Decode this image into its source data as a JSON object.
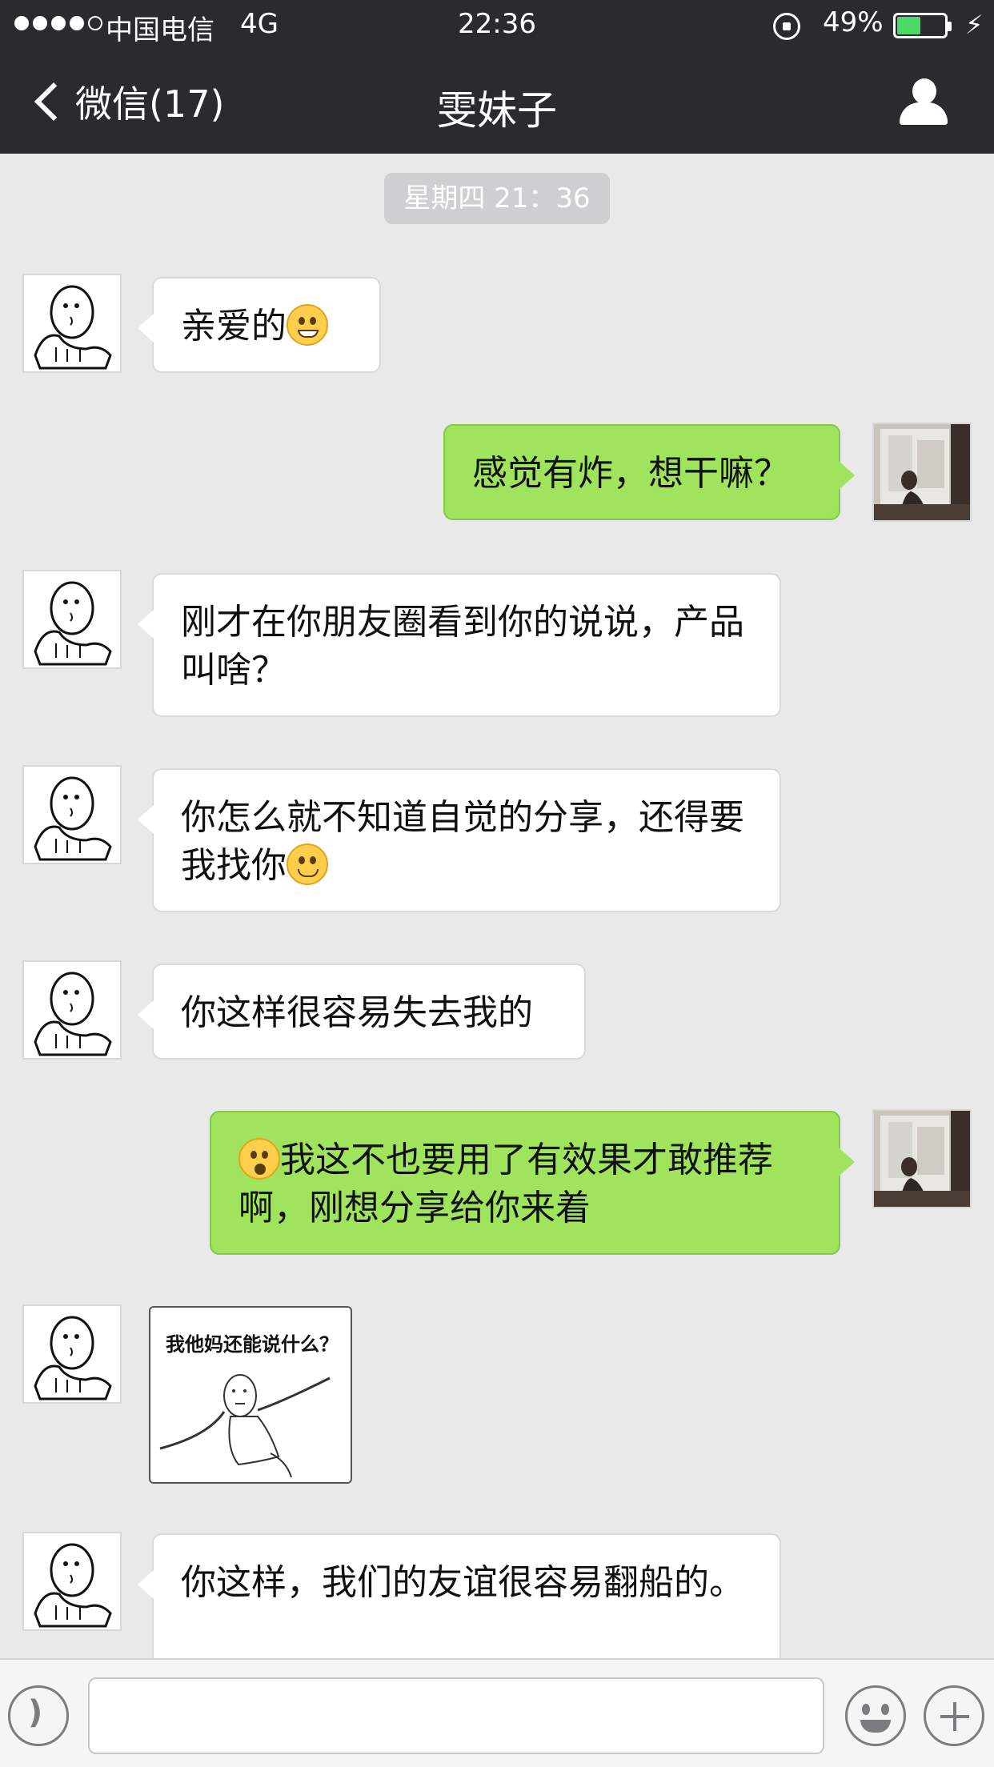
{
  "status_bar": {
    "carrier": "中国电信",
    "network": "4G",
    "time": "22:36",
    "battery_percent": "49%",
    "battery_level": 0.49
  },
  "nav": {
    "back_label": "微信(17)",
    "title": "雯妹子"
  },
  "chat": {
    "timestamp": "星期四 21：36",
    "messages": [
      {
        "from": "them",
        "text": "亲爱的"
      },
      {
        "from": "me",
        "text": "感觉有炸，想干嘛？"
      },
      {
        "from": "them",
        "text": "刚才在你朋友圈看到你的说说，产品叫啥？"
      },
      {
        "from": "them",
        "text": "你怎么就不知道自觉的分享，还得要我找你"
      },
      {
        "from": "them",
        "text": "你这样很容易失去我的"
      },
      {
        "from": "me",
        "text": "我这不也要用了有效果才敢推荐啊，刚想分享给你来着"
      },
      {
        "from": "them",
        "type": "sticker",
        "text": "我他妈还能说什么？"
      },
      {
        "from": "them",
        "text": "你这样，我们的友谊很容易翻船的。"
      }
    ]
  },
  "colors": {
    "bar_bg": "#2a2b2f",
    "chat_bg": "#e9e9ea",
    "outgoing_bubble": "#a0e45e",
    "incoming_bubble": "#ffffff",
    "battery_fill": "#4cd964"
  },
  "icons": {
    "back": "chevron-left-icon",
    "profile": "person-icon",
    "voice": "voice-icon",
    "emoji": "emoji-face-icon",
    "plus": "plus-icon"
  }
}
